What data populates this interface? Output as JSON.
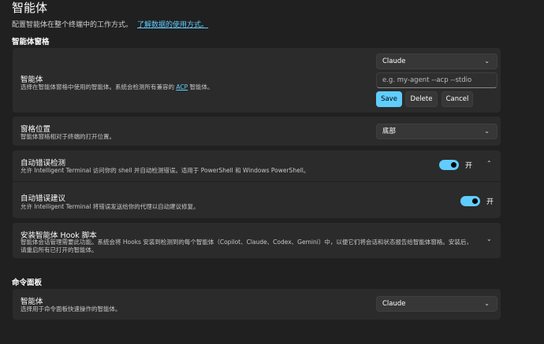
{
  "page": {
    "title": "智能体",
    "description": "配置智能体在整个终端中的工作方式。",
    "link": "了解数据的使用方式。"
  },
  "sections": {
    "agent_pane": "智能体窗格",
    "command_palette": "命令面板"
  },
  "agent_card": {
    "label": "智能体",
    "desc_prefix": "选择在智能体窗格中使用的智能体。系统会检测所有兼容的",
    "desc_link": "ACP",
    "desc_suffix": "智能体。",
    "select_value": "Claude",
    "input_placeholder": "e.g. my-agent --acp --stdio",
    "save_label": "Save",
    "delete_label": "Delete",
    "cancel_label": "Cancel"
  },
  "pane_position": {
    "label": "窗格位置",
    "desc": "智能体窗格相对于终端的打开位置。",
    "select_value": "底部"
  },
  "auto_error_detection": {
    "label": "自动错误检测",
    "desc": "允许 Intelligent Terminal 访问你的 shell 并自动检测错误。适用于 PowerShell 和 Windows PowerShell。",
    "toggle_state": "开"
  },
  "auto_error_suggestion": {
    "label": "自动错误建议",
    "desc": "允许 Intelligent Terminal 将错误发送给你的代理以自动建议修复。",
    "toggle_state": "开"
  },
  "hook_install": {
    "label": "安装智能体 Hook 脚本",
    "desc_line1": "智能体会话管理需要此功能。系统会将 Hooks 安装到检测到的每个智能体（Copilot、Claude、Codex、Gemini）中，以便它们将会话和状态报告给智能体窗格。安装后，",
    "desc_line2": "请重启所有已打开的智能体。"
  },
  "palette_agent": {
    "label": "智能体",
    "desc": "选择用于命令面板快速操作的智能体。",
    "select_value": "Claude"
  },
  "colors": {
    "accent": "#60cdff",
    "background": "#202020",
    "card": "#2b2b2b"
  }
}
